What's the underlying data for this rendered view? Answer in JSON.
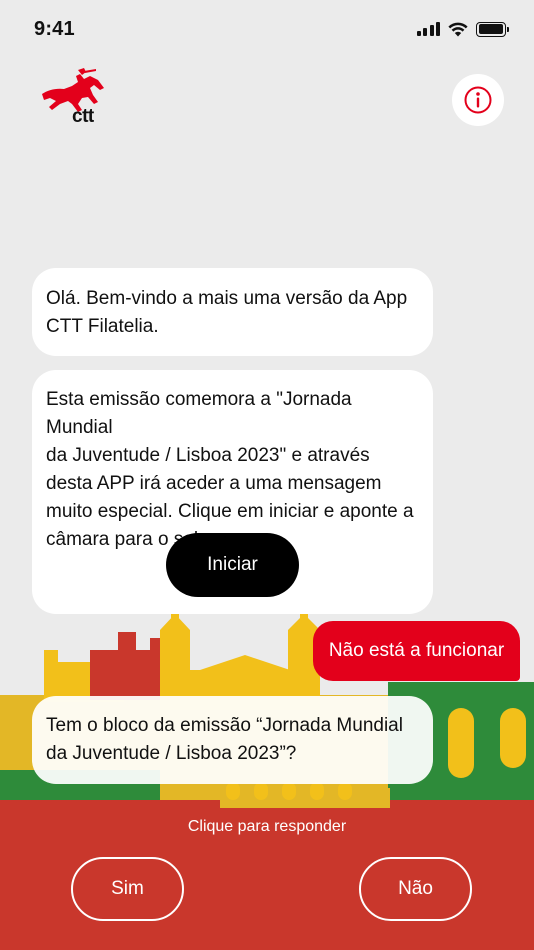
{
  "status_bar": {
    "time": "9:41"
  },
  "header": {
    "logo_text": "ctt",
    "info_icon": "info-icon"
  },
  "messages": [
    {
      "from": "bot",
      "text": "Olá. Bem-vindo a mais uma versão da App\nCTT Filatelia."
    },
    {
      "from": "bot",
      "text": "Esta emissão comemora a \"Jornada Mundial\nda Juventude / Lisboa 2023\" e através\ndesta APP irá aceder a uma mensagem\nmuito especial. Clique em iniciar e aponte a\ncâmara para o selo.",
      "button_label": "Iniciar"
    },
    {
      "from": "user",
      "text": "Não está a funcionar"
    },
    {
      "from": "bot",
      "text": "Tem o bloco da emissão “Jornada Mundial\nda Juventude / Lisboa 2023”?"
    }
  ],
  "reply_panel": {
    "prompt": "Clique para responder",
    "yes_label": "Sim",
    "no_label": "Não"
  },
  "colors": {
    "brand_red": "#e3001b",
    "panel_red": "#c9372c",
    "background": "#ebebeb"
  }
}
